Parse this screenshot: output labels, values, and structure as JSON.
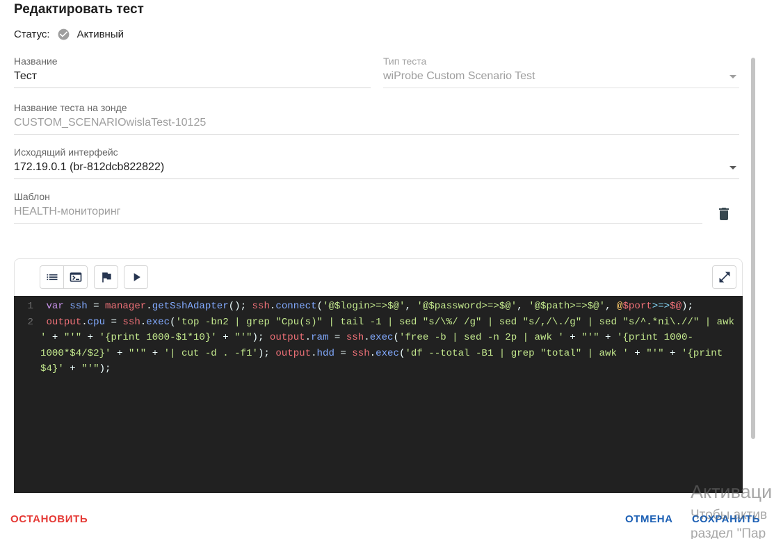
{
  "dialog": {
    "title": "Редактировать тест",
    "status": {
      "label": "Статус:",
      "value": "Активный",
      "icon": "check-circle-icon"
    }
  },
  "fields": {
    "name": {
      "label": "Название",
      "value": "Тест"
    },
    "test_type": {
      "label": "Тип теста",
      "value": "wiProbe Custom Scenario Test",
      "disabled": true,
      "icon": "arrow-drop-down-icon"
    },
    "probe_test_name": {
      "label": "Название теста на зонде",
      "value": "CUSTOM_SCENARIOwislaTest-10125",
      "disabled": true
    },
    "outgoing_interface": {
      "label": "Исходящий интерфейс",
      "value": "172.19.0.1 (br-812dcb822822)",
      "icon": "arrow-drop-down-icon"
    },
    "template": {
      "label": "Шаблон",
      "value": "HEALTH-мониторинг",
      "disabled": true,
      "action_icon": "trash-icon"
    }
  },
  "editor": {
    "toolbar": {
      "left": [
        "list-icon",
        "terminal-icon",
        "flag-icon",
        "play-icon"
      ],
      "right": [
        "expand-icon"
      ]
    },
    "lines": [
      {
        "number": "1",
        "rows": [
          [
            [
              "var",
              "#c792ea"
            ],
            [
              " ",
              "#eeffff"
            ],
            [
              "ssh",
              "#82aaff"
            ],
            [
              " = ",
              "#eeffff"
            ],
            [
              "manager",
              "#f07178"
            ],
            [
              ".",
              "#eeffff"
            ],
            [
              "getSshAdapter",
              "#82aaff"
            ],
            [
              "(); ",
              "#eeffff"
            ],
            [
              "ssh",
              "#f07178"
            ],
            [
              ".",
              "#eeffff"
            ],
            [
              "connect",
              "#82aaff"
            ],
            [
              "(",
              "#eeffff"
            ],
            [
              "'@$login>=>$@'",
              "#c3e88d"
            ],
            [
              ", ",
              "#eeffff"
            ],
            [
              "'@$password>=>$@'",
              "#c3e88d"
            ],
            [
              ", ",
              "#eeffff"
            ],
            [
              "'@$path>=>$@'",
              "#c3e88d"
            ],
            [
              ", ",
              "#eeffff"
            ],
            [
              "@",
              "#ffcb6b"
            ],
            [
              "$port",
              "#f07178"
            ],
            [
              ">=>",
              "#89ddff"
            ],
            [
              "$@",
              "#f07178"
            ],
            [
              ");",
              "#eeffff"
            ]
          ]
        ]
      },
      {
        "number": "2",
        "rows": [
          [
            [
              "output",
              "#f07178"
            ],
            [
              ".",
              "#eeffff"
            ],
            [
              "cpu",
              "#82aaff"
            ],
            [
              " = ",
              "#eeffff"
            ],
            [
              "ssh",
              "#f07178"
            ],
            [
              ".",
              "#eeffff"
            ],
            [
              "exec",
              "#82aaff"
            ],
            [
              "(",
              "#eeffff"
            ],
            [
              "'top -bn2 | grep \"Cpu(s)\" | tail -1 | sed \"s/\\%/ /g\" | sed \"s/,/\\./g\" | sed \"s/^.*ni\\.//\" | awk",
              "#c3e88d"
            ]
          ],
          [
            [
              "'",
              "#c3e88d"
            ],
            [
              " + ",
              "#eeffff"
            ],
            [
              "\"'\"",
              "#c3e88d"
            ],
            [
              " + ",
              "#eeffff"
            ],
            [
              "'{print 1000-$1*10}'",
              "#c3e88d"
            ],
            [
              " + ",
              "#eeffff"
            ],
            [
              "\"'\"",
              "#c3e88d"
            ],
            [
              "); ",
              "#eeffff"
            ],
            [
              "output",
              "#f07178"
            ],
            [
              ".",
              "#eeffff"
            ],
            [
              "ram",
              "#82aaff"
            ],
            [
              " = ",
              "#eeffff"
            ],
            [
              "ssh",
              "#f07178"
            ],
            [
              ".",
              "#eeffff"
            ],
            [
              "exec",
              "#82aaff"
            ],
            [
              "(",
              "#eeffff"
            ],
            [
              "'free -b | sed -n 2p | awk '",
              "#c3e88d"
            ],
            [
              " + ",
              "#eeffff"
            ],
            [
              "\"'\"",
              "#c3e88d"
            ],
            [
              " + ",
              "#eeffff"
            ],
            [
              "'{print 1000-",
              "#c3e88d"
            ]
          ],
          [
            [
              "1000*$4/$2}'",
              "#c3e88d"
            ],
            [
              " + ",
              "#eeffff"
            ],
            [
              "\"'\"",
              "#c3e88d"
            ],
            [
              " + ",
              "#eeffff"
            ],
            [
              "'| cut -d . -f1'",
              "#c3e88d"
            ],
            [
              "); ",
              "#eeffff"
            ],
            [
              "output",
              "#f07178"
            ],
            [
              ".",
              "#eeffff"
            ],
            [
              "hdd",
              "#82aaff"
            ],
            [
              " = ",
              "#eeffff"
            ],
            [
              "ssh",
              "#f07178"
            ],
            [
              ".",
              "#eeffff"
            ],
            [
              "exec",
              "#82aaff"
            ],
            [
              "(",
              "#eeffff"
            ],
            [
              "'df --total -B1 | grep \"total\" | awk '",
              "#c3e88d"
            ],
            [
              " + ",
              "#eeffff"
            ],
            [
              "\"'\"",
              "#c3e88d"
            ],
            [
              " + ",
              "#eeffff"
            ],
            [
              "'{print",
              "#c3e88d"
            ]
          ],
          [
            [
              "$4}'",
              "#c3e88d"
            ],
            [
              " + ",
              "#eeffff"
            ],
            [
              "\"'\"",
              "#c3e88d"
            ],
            [
              ");",
              "#eeffff"
            ]
          ]
        ]
      }
    ]
  },
  "actions": {
    "stop": "ОСТАНОВИТЬ",
    "cancel": "ОТМЕНА",
    "save": "СОХРАНИТЬ"
  },
  "watermark": {
    "title": "Активаци",
    "line1": "Чтобы актив",
    "line2": "раздел \"Пар"
  },
  "colors": {
    "danger": "#e53935",
    "primary": "#1b5fb4",
    "disabled_text": "#9e9e9e",
    "icon": "#263550",
    "editor_background": "#212121"
  }
}
